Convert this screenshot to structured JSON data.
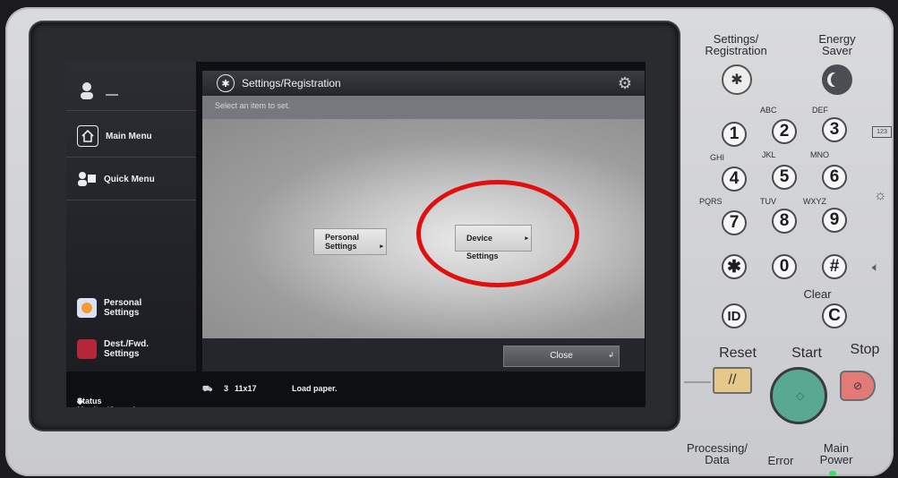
{
  "screen": {
    "title": "Settings/Registration",
    "instruction": "Select an item to set.",
    "options": [
      {
        "line1": "Personal",
        "line2": "Settings"
      },
      {
        "line1": "Device Settings",
        "line2": ""
      }
    ],
    "close_label": "Close"
  },
  "sidebar": {
    "main_menu": "Main Menu",
    "quick_menu": "Quick Menu",
    "personal_settings": [
      "Personal",
      "Settings"
    ],
    "dest_fwd_settings": [
      "Dest./Fwd.",
      "Settings"
    ]
  },
  "status_bar": {
    "monitor_label": "Status Monitor/Cancel",
    "tray_number": "3",
    "paper_size": "11x17",
    "message": "Load paper."
  },
  "panel": {
    "settings_registration": [
      "Settings/",
      "Registration"
    ],
    "energy_saver": [
      "Energy",
      "Saver"
    ],
    "keys": [
      "1",
      "2",
      "3",
      "4",
      "5",
      "6",
      "7",
      "8",
      "9",
      "0"
    ],
    "letters": [
      "ABC",
      "DEF",
      "GHI",
      "JKL",
      "MNO",
      "PQRS",
      "TUV",
      "WXYZ"
    ],
    "clear_key": "C",
    "clear_label": "Clear",
    "id_key": "ID",
    "reset": "Reset",
    "start": "Start",
    "stop": "Stop",
    "processing_data": [
      "Processing/",
      "Data"
    ],
    "error": "Error",
    "main_power": [
      "Main",
      "Power"
    ],
    "counter_badge": "123"
  },
  "colors": {
    "highlight": "#e11010",
    "start_button": "#59a890",
    "stop_button": "#e27a78",
    "reset_button": "#e6c98a"
  }
}
